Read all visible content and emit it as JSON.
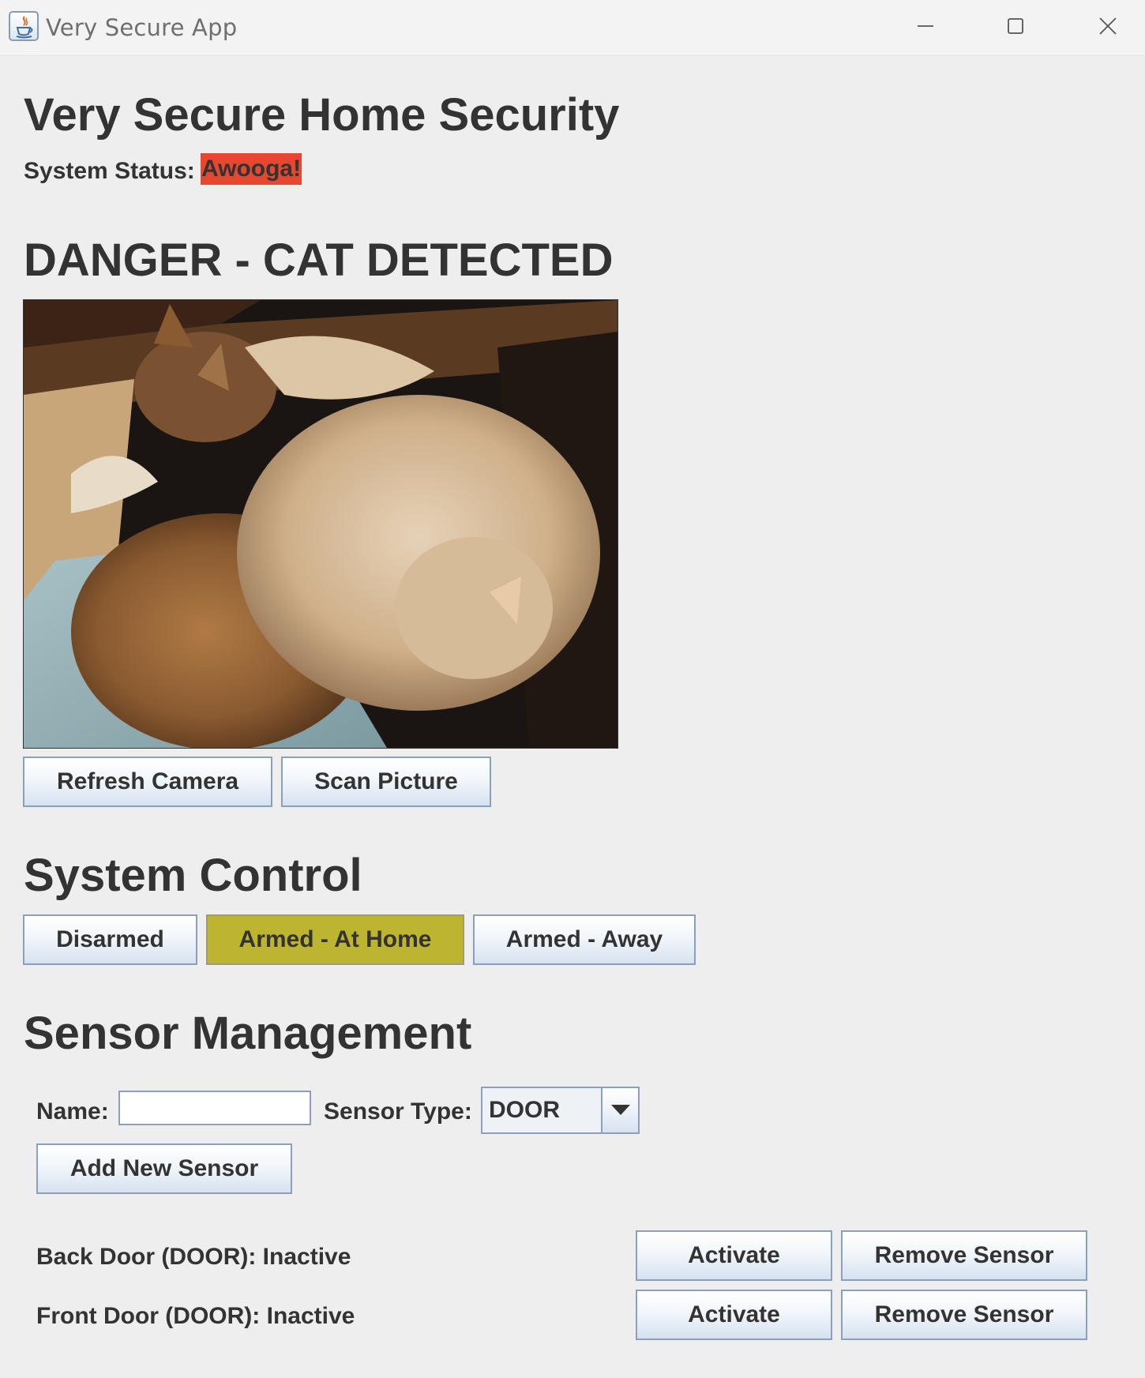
{
  "window": {
    "title": "Very Secure App",
    "icon": "java-cup-icon"
  },
  "header": {
    "title": "Very Secure Home Security",
    "status_label": "System Status:",
    "status_value": "Awooga!",
    "status_color": "#e8472f"
  },
  "camera": {
    "heading": "DANGER - CAT DETECTED",
    "refresh_label": "Refresh Camera",
    "scan_label": "Scan Picture"
  },
  "system_control": {
    "heading": "System Control",
    "modes": [
      {
        "label": "Disarmed",
        "selected": false
      },
      {
        "label": "Armed - At Home",
        "selected": true
      },
      {
        "label": "Armed - Away",
        "selected": false
      }
    ],
    "selected_color": "#bdb42f"
  },
  "sensor_management": {
    "heading": "Sensor Management",
    "name_label": "Name:",
    "name_value": "",
    "type_label": "Sensor Type:",
    "type_value": "DOOR",
    "add_label": "Add New Sensor",
    "sensors": [
      {
        "label": "Back Door (DOOR): Inactive",
        "activate_label": "Activate",
        "remove_label": "Remove Sensor"
      },
      {
        "label": "Front Door (DOOR): Inactive",
        "activate_label": "Activate",
        "remove_label": "Remove Sensor"
      }
    ]
  }
}
